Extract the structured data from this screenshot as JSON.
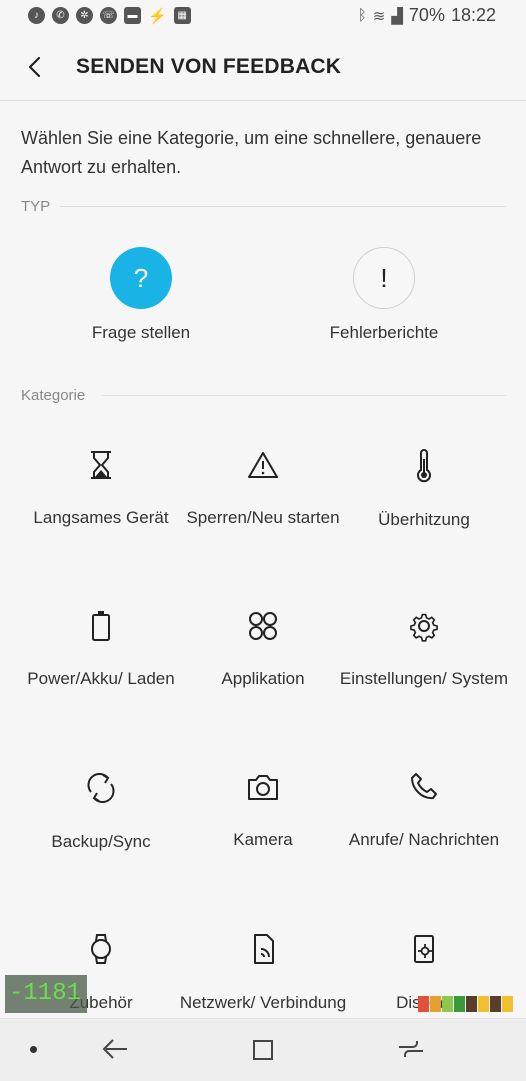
{
  "status": {
    "battery": "70%",
    "time": "18:22",
    "left_icons": [
      "music-icon",
      "whatsapp-icon",
      "pinwheel-icon",
      "viber-icon",
      "message-icon",
      "bolt-icon",
      "calendar-icon"
    ],
    "right_icons": [
      "bluetooth-icon",
      "wifi-icon",
      "signal-icon"
    ]
  },
  "header": {
    "title": "SENDEN VON FEEDBACK",
    "back_icon": "back-arrow-icon"
  },
  "description": "Wählen Sie eine Kategorie, um eine schnellere, genauere Antwort zu erhalten.",
  "type_section": {
    "label": "TYP",
    "items": [
      {
        "glyph": "?",
        "label": "Frage stellen",
        "selected": true,
        "color": "#1ab3e6"
      },
      {
        "glyph": "!",
        "label": "Fehlerberichte",
        "selected": false
      }
    ]
  },
  "category_section": {
    "label": "Kategorie",
    "items": [
      {
        "icon": "hourglass-icon",
        "label": "Langsames Gerät"
      },
      {
        "icon": "warning-icon",
        "label": "Sperren/Neu starten"
      },
      {
        "icon": "thermometer-icon",
        "label": "Überhitzung"
      },
      {
        "icon": "battery-icon",
        "label": "Power/Akku/ Laden"
      },
      {
        "icon": "apps-icon",
        "label": "Applikation"
      },
      {
        "icon": "gear-icon",
        "label": "Einstellungen/ System"
      },
      {
        "icon": "sync-icon",
        "label": "Backup/Sync"
      },
      {
        "icon": "camera-icon",
        "label": "Kamera"
      },
      {
        "icon": "phone-icon",
        "label": "Anrufe/ Nachrichten"
      },
      {
        "icon": "watch-icon",
        "label": "Zubehör"
      },
      {
        "icon": "network-icon",
        "label": "Netzwerk/ Verbindung"
      },
      {
        "icon": "display-icon",
        "label": "Display"
      }
    ]
  },
  "overlay": {
    "debug_value": "-1181"
  },
  "navbar": {
    "icons": [
      "dot-indicator-icon",
      "back-icon",
      "home-icon",
      "recents-icon"
    ]
  }
}
